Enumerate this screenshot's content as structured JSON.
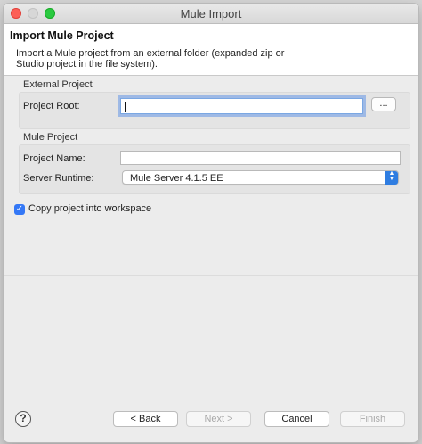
{
  "window": {
    "title": "Mule Import"
  },
  "header": {
    "title": "Import Mule Project",
    "description": "Import a Mule project from an external folder (expanded zip or Studio project in the file system)."
  },
  "external_project": {
    "group_label": "External Project",
    "project_root_label": "Project Root:",
    "project_root_value": "",
    "browse_label": "..."
  },
  "mule_project": {
    "group_label": "Mule Project",
    "project_name_label": "Project Name:",
    "project_name_value": "",
    "server_runtime_label": "Server Runtime:",
    "server_runtime_value": "Mule Server 4.1.5 EE"
  },
  "copy_option": {
    "label": "Copy project into workspace",
    "checked": true
  },
  "footer": {
    "help_glyph": "?",
    "back_label": "< Back",
    "next_label": "Next >",
    "cancel_label": "Cancel",
    "finish_label": "Finish"
  },
  "colors": {
    "accent": "#3478f6",
    "close": "#fc5f57",
    "zoom": "#2ac940"
  }
}
